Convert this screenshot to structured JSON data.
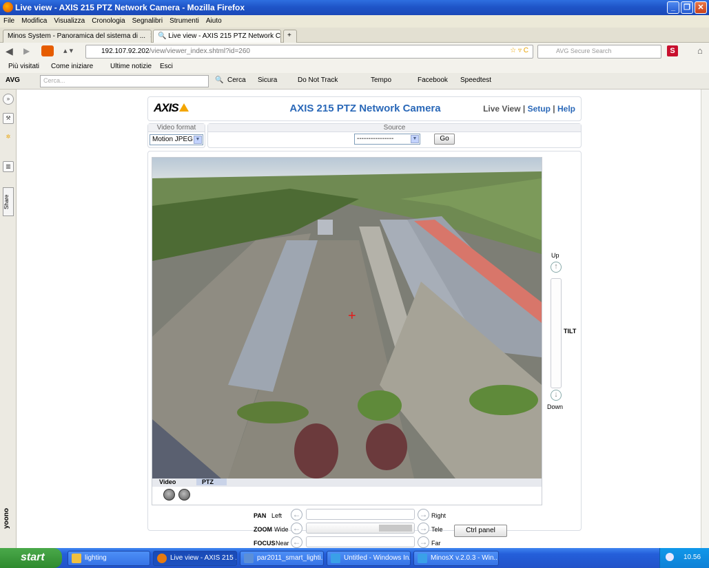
{
  "window": {
    "title": "Live view - AXIS 215 PTZ Network Camera - Mozilla Firefox"
  },
  "menu": [
    "File",
    "Modifica",
    "Visualizza",
    "Cronologia",
    "Segnalibri",
    "Strumenti",
    "Aiuto"
  ],
  "tabs": [
    {
      "label": "Minos System - Panoramica del sistema di ...",
      "active": false
    },
    {
      "label": "Live view - AXIS 215 PTZ Network Camera",
      "active": true
    }
  ],
  "nav": {
    "url_host": "192.107.92.202",
    "url_path": "/view/viewer_index.shtml?id=260",
    "search_placeholder": "AVG Secure Search"
  },
  "bookmarks": [
    "Più visitati",
    "Come iniziare",
    "Ultime notizie",
    "Esci"
  ],
  "avg": {
    "label": "AVG",
    "search_placeholder": "Cerca...",
    "items": [
      "Cerca",
      "Sicura",
      "Do Not Track",
      "Tempo",
      "Facebook",
      "Speedtest"
    ]
  },
  "sidebar": {
    "share": "Share",
    "brand": "yoono"
  },
  "camera": {
    "logo": "AXIS",
    "title": "AXIS 215 PTZ Network Camera",
    "nav_current": "Live View",
    "nav_sep": "|",
    "nav_setup": "Setup",
    "nav_help": "Help",
    "video_format_label": "Video format",
    "video_format_value": "Motion JPEG",
    "source_label": "Source",
    "source_value": "----------------",
    "go_label": "Go",
    "tab_video": "Video",
    "tab_ptz": "PTZ",
    "tilt_up": "Up",
    "tilt_label": "TILT",
    "tilt_down": "Down",
    "pan_label": "PAN",
    "pan_left": "Left",
    "pan_right": "Right",
    "zoom_label": "ZOOM",
    "zoom_left": "Wide",
    "zoom_right": "Tele",
    "focus_label": "FOCUS",
    "focus_left": "Near",
    "focus_right": "Far",
    "ctrl_panel": "Ctrl panel"
  },
  "taskbar": {
    "start": "start",
    "tasks": [
      "lighting",
      "Live view - AXIS 215 ...",
      "par2011_smart_lighti...",
      "Untitled - Windows In...",
      "MinosX v.2.0.3 - Win..."
    ],
    "clock": "10.56"
  },
  "colors": {
    "axis_blue": "#2a68b8",
    "axis_yellow": "#f3a500",
    "xp_blue": "#245fda"
  }
}
